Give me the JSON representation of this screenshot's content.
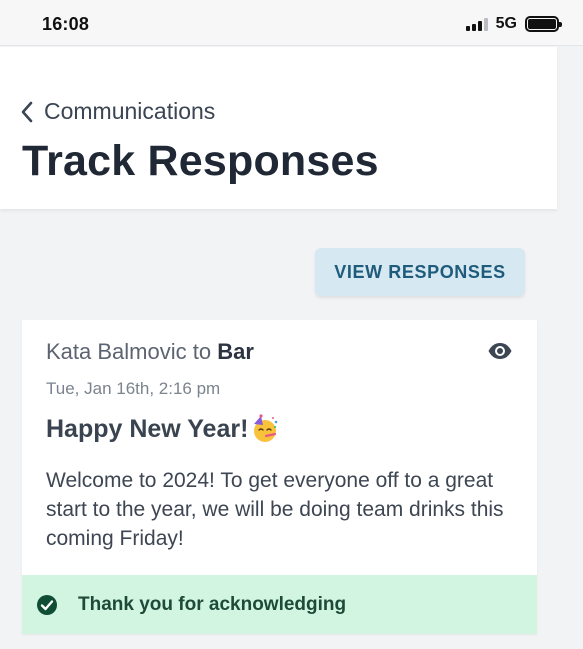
{
  "status_bar": {
    "time": "16:08",
    "network": "5G"
  },
  "header": {
    "back_label": "Communications",
    "title": "Track Responses"
  },
  "actions": {
    "view_responses_label": "VIEW RESPONSES"
  },
  "message": {
    "sender": "Kata Balmovic",
    "connector": "to",
    "recipient": "Bar",
    "date": "Tue, Jan 16th, 2:16 pm",
    "title": "Happy New Year!",
    "title_emoji": "partying-face-emoji",
    "body": "Welcome to 2024! To get everyone off to a great start to the year, we will be doing team drinks this coming Friday!",
    "acknowledgement": "Thank you for acknowledging"
  },
  "icons": {
    "back": "chevron-left-icon",
    "view": "eye-icon",
    "acknowledged": "check-circle-icon"
  },
  "colors": {
    "accent": "#1f5b7a",
    "button_bg": "#d6e8f2",
    "ack_bg": "#d1f5e1",
    "ack_text": "#1e4a38",
    "check": "#0f4d35"
  }
}
